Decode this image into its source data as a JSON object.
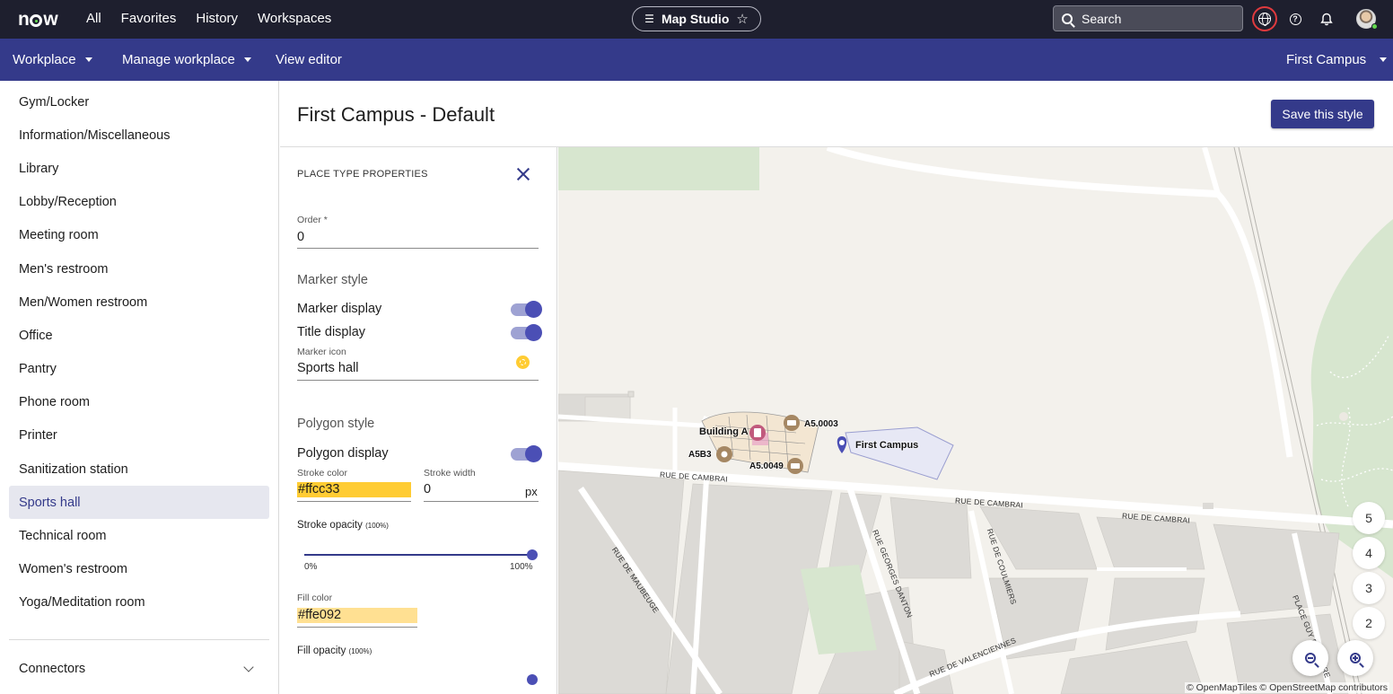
{
  "topbar": {
    "logo": "now",
    "nav": [
      "All",
      "Favorites",
      "History",
      "Workspaces"
    ],
    "app_name": "Map Studio",
    "search_placeholder": "Search"
  },
  "subbar": {
    "workplace": "Workplace",
    "manage_workplace": "Manage workplace",
    "view_editor": "View editor",
    "campus": "First Campus"
  },
  "sidebar": {
    "items": [
      {
        "label": "Gym/Locker"
      },
      {
        "label": "Information/Miscellaneous"
      },
      {
        "label": "Library"
      },
      {
        "label": "Lobby/Reception"
      },
      {
        "label": "Meeting room"
      },
      {
        "label": "Men's restroom"
      },
      {
        "label": "Men/Women restroom"
      },
      {
        "label": "Office"
      },
      {
        "label": "Pantry"
      },
      {
        "label": "Phone room"
      },
      {
        "label": "Printer"
      },
      {
        "label": "Sanitization station"
      },
      {
        "label": "Sports hall",
        "active": true
      },
      {
        "label": "Technical room"
      },
      {
        "label": "Women's restroom"
      },
      {
        "label": "Yoga/Meditation room"
      }
    ],
    "connectors": "Connectors"
  },
  "page": {
    "title": "First Campus - Default",
    "save_button": "Save this style"
  },
  "panel": {
    "caption": "PLACE TYPE PROPERTIES",
    "order_label": "Order *",
    "order_value": "0",
    "marker_section": "Marker style",
    "marker_display": "Marker display",
    "title_display": "Title display",
    "marker_icon_label": "Marker icon",
    "marker_icon_value": "Sports hall",
    "polygon_section": "Polygon style",
    "polygon_display": "Polygon display",
    "stroke_color_label": "Stroke color",
    "stroke_color_value": "#ffcc33",
    "stroke_width_label": "Stroke width",
    "stroke_width_value": "0",
    "stroke_width_unit": "px",
    "stroke_opacity_label": "Stroke opacity",
    "stroke_opacity_hint": "(100%)",
    "stroke_opacity_value": 1.0,
    "slider_min": "0%",
    "slider_max": "100%",
    "fill_color_label": "Fill color",
    "fill_color_value": "#ffe092",
    "fill_opacity_label": "Fill opacity",
    "fill_opacity_hint": "(100%)"
  },
  "map": {
    "labels": {
      "building_a": "Building A",
      "a5003": "A5.0003",
      "a5b3": "A5B3",
      "a50049": "A5.0049",
      "first_campus": "First Campus"
    },
    "streets": {
      "rue_de_cambrai_1": "RUE DE CAMBRAI",
      "rue_de_cambrai_2": "RUE DE CAMBRAI",
      "rue_de_cambrai_3": "RUE DE CAMBRAI",
      "rue_de_maubeuge": "RUE DE MAUBEUGE",
      "rue_georges_danton": "RUE GEORGES DANTON",
      "rue_de_coulmiers": "RUE DE COULMIERS",
      "rue_de_valenciennes": "RUE DE VALENCIENNES",
      "place_guy": "PLACE GUY DE LA BRE"
    },
    "floors": [
      "5",
      "4",
      "3",
      "2"
    ],
    "attribution": "© OpenMapTiles © OpenStreetMap contributors"
  },
  "colors": {
    "accent": "#343a8a",
    "topbar": "#1e1f2e",
    "stroke": "#ffcc33",
    "fill": "#ffe092"
  }
}
